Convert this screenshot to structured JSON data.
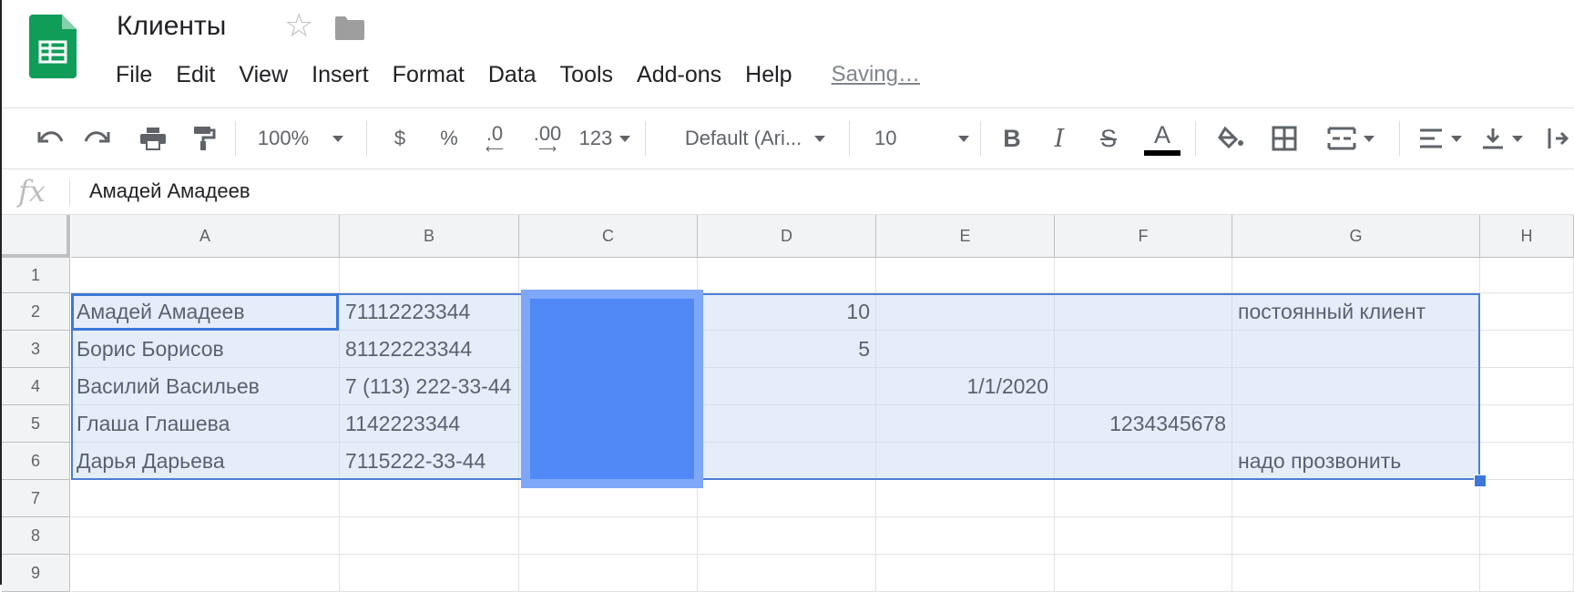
{
  "app": {
    "title": "Клиенты",
    "star_glyph": "☆",
    "saving_status": "Saving…"
  },
  "menu": [
    "File",
    "Edit",
    "View",
    "Insert",
    "Format",
    "Data",
    "Tools",
    "Add-ons",
    "Help"
  ],
  "toolbar": {
    "zoom": "100%",
    "currency_label": "$",
    "percent_label": "%",
    "decrease_decimal_label": ".0",
    "increase_decimal_label": ".00",
    "more_formats_label": "123",
    "font_family": "Default (Ari...",
    "font_size": "10",
    "bold_label": "B",
    "italic_label": "I",
    "strikethrough_label": "S",
    "text_color_label": "A"
  },
  "formula_bar": {
    "fx_label": "fx",
    "value": "Амадей Амадеев"
  },
  "grid": {
    "columns": [
      "A",
      "B",
      "C",
      "D",
      "E",
      "F",
      "G",
      "H"
    ],
    "rows": [
      "1",
      "2",
      "3",
      "4",
      "5",
      "6",
      "7",
      "8",
      "9"
    ],
    "cells": {
      "A2": "Амадей Амадеев",
      "A3": "Борис Борисов",
      "A4": "Василий Васильев",
      "A5": "Глаша Глашева",
      "A6": "Дарья Дарьева",
      "B2": "71112223344",
      "B3": "81122223344",
      "B4": "7 (113) 222-33-44",
      "B5": "1142223344",
      "B6": "7115222-33-44",
      "D2": "10",
      "D3": "5",
      "E4": "1/1/2020",
      "F5": "1234345678",
      "G2": "постоянный клиент",
      "G6": "надо прозвонить"
    },
    "active_cell": "A2",
    "selection": "A2:G6"
  },
  "colors": {
    "sheets_green": "#0f9d58",
    "selection_border": "#3c78d8",
    "redaction_block": "#5089f5"
  }
}
